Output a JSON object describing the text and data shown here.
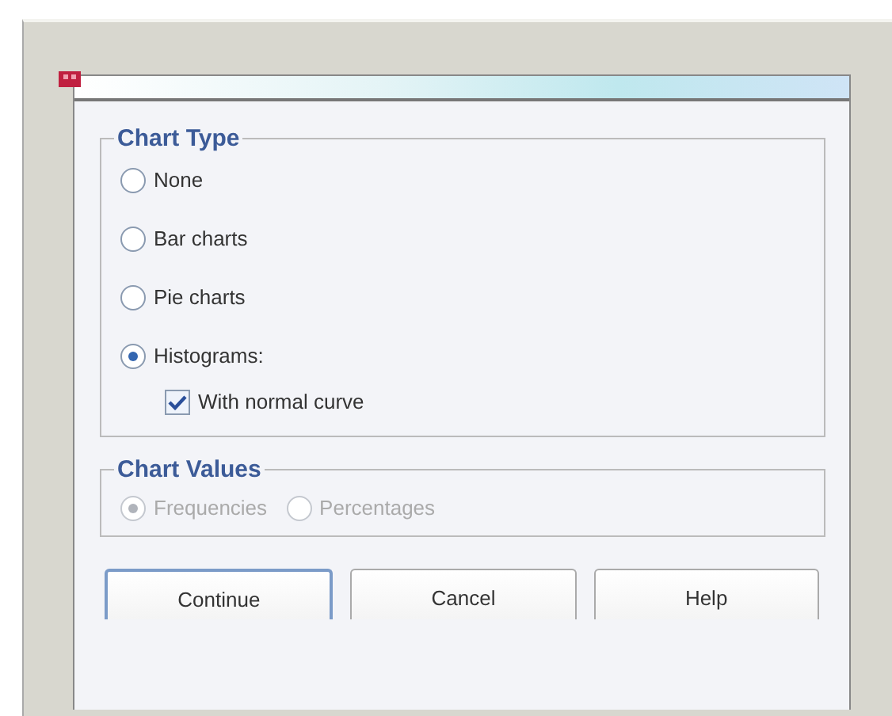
{
  "chart_type": {
    "title": "Chart Type",
    "options": [
      {
        "label": "None",
        "selected": false
      },
      {
        "label": "Bar charts",
        "selected": false
      },
      {
        "label": "Pie charts",
        "selected": false
      },
      {
        "label": "Histograms:",
        "selected": true
      }
    ],
    "normal_curve": {
      "label": "With normal curve",
      "checked": true
    }
  },
  "chart_values": {
    "title": "Chart Values",
    "disabled": true,
    "options": [
      {
        "label": "Frequencies",
        "selected": true
      },
      {
        "label": "Percentages",
        "selected": false
      }
    ]
  },
  "buttons": [
    {
      "label": "Continue",
      "selected": true
    },
    {
      "label": "Cancel",
      "selected": false
    },
    {
      "label": "Help",
      "selected": false
    }
  ]
}
